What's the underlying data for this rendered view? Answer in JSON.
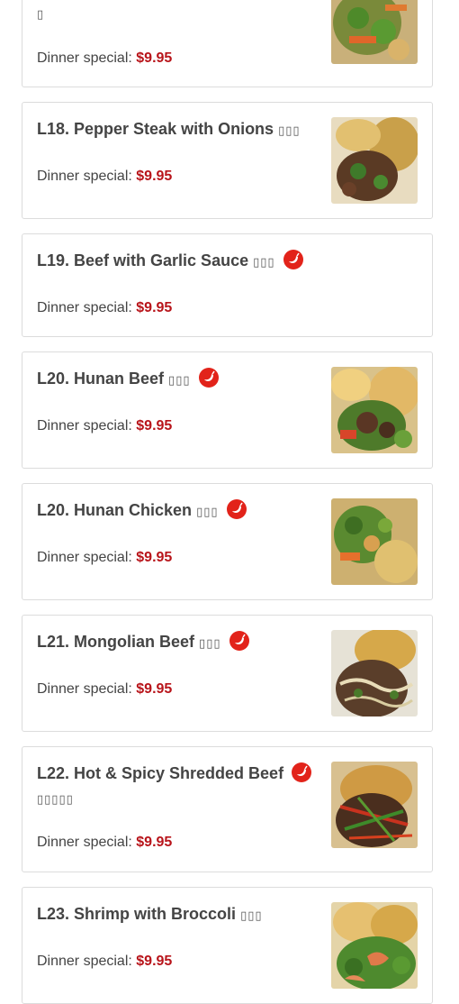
{
  "menu": {
    "price_label": "Dinner special:",
    "items": [
      {
        "title": "",
        "cn": "▯",
        "price": "$9.95",
        "spicy": false
      },
      {
        "title": "L18. Pepper Steak with Onions",
        "cn": "▯▯▯",
        "price": "$9.95",
        "spicy": false
      },
      {
        "title": "L19. Beef with Garlic Sauce",
        "cn": "▯▯▯",
        "price": "$9.95",
        "spicy": true
      },
      {
        "title": "L20. Hunan Beef",
        "cn": "▯▯▯",
        "price": "$9.95",
        "spicy": true
      },
      {
        "title": "L20. Hunan Chicken",
        "cn": "▯▯▯",
        "price": "$9.95",
        "spicy": true
      },
      {
        "title": "L21. Mongolian Beef",
        "cn": "▯▯▯",
        "price": "$9.95",
        "spicy": true
      },
      {
        "title": "L22. Hot & Spicy Shredded Beef",
        "cn": "▯▯▯▯▯",
        "price": "$9.95",
        "spicy": true
      },
      {
        "title": "L23. Shrimp with Broccoli",
        "cn": "▯▯▯",
        "price": "$9.95",
        "spicy": false
      }
    ]
  },
  "colors": {
    "price": "#b8141a",
    "chili": "#e2231a",
    "border": "#dcdcdc"
  },
  "icons": {
    "spicy": "chili-pepper-icon"
  }
}
